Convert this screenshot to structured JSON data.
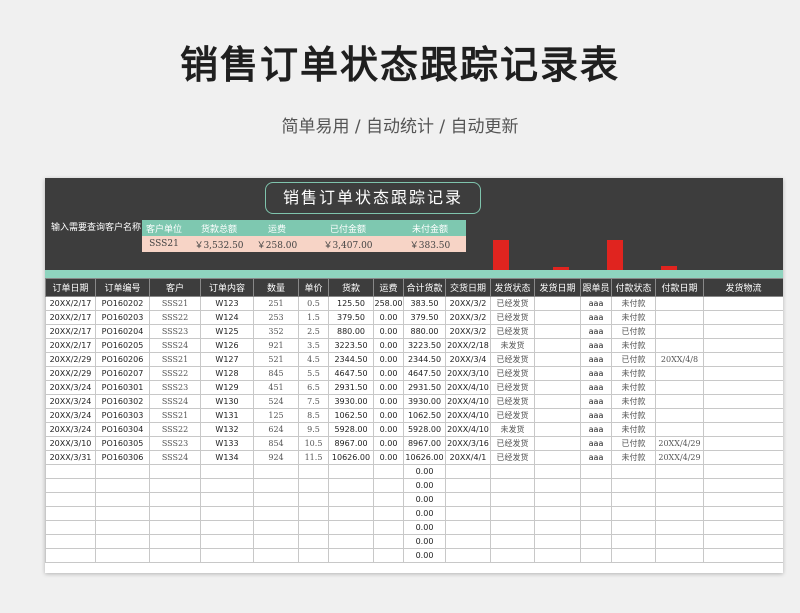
{
  "page": {
    "title": "销售订单状态跟踪记录表",
    "subtitle": "简单易用  /  自动统计  /  自动更新"
  },
  "sheet": {
    "title": "销售订单状态跟踪记录",
    "query_label": "输入需要查询客户名称",
    "summary": {
      "headers": [
        "客户单位",
        "货款总额",
        "运费",
        "已付金额",
        "未付金额"
      ],
      "values": [
        "SSS21",
        "￥3,532.50",
        "￥258.00",
        "￥3,407.00",
        "￥383.50"
      ]
    },
    "chart_data": {
      "type": "bar",
      "categories": [
        "货款总额",
        "运费",
        "已付金额",
        "未付金额"
      ],
      "values": [
        3532.5,
        258,
        3407,
        383.5
      ],
      "title": "",
      "colors": [
        "#e0241f"
      ]
    },
    "table": {
      "columns": [
        "订单日期",
        "订单编号",
        "客户",
        "订单内容",
        "数量",
        "单价",
        "货款",
        "运费",
        "合计货款",
        "交货日期",
        "发货状态",
        "发货日期",
        "跟单员",
        "付款状态",
        "付款日期",
        "发货物流"
      ],
      "rows": [
        [
          "20XX/2/17",
          "PO160202",
          "SSS21",
          "W123",
          "251",
          "0.5",
          "125.50",
          "258.00",
          "383.50",
          "20XX/3/2",
          "已经发货",
          "",
          "aaa",
          "未付款",
          "",
          ""
        ],
        [
          "20XX/2/17",
          "PO160203",
          "SSS22",
          "W124",
          "253",
          "1.5",
          "379.50",
          "0.00",
          "379.50",
          "20XX/3/2",
          "已经发货",
          "",
          "aaa",
          "未付款",
          "",
          ""
        ],
        [
          "20XX/2/17",
          "PO160204",
          "SSS23",
          "W125",
          "352",
          "2.5",
          "880.00",
          "0.00",
          "880.00",
          "20XX/3/2",
          "已经发货",
          "",
          "aaa",
          "已付款",
          "",
          ""
        ],
        [
          "20XX/2/17",
          "PO160205",
          "SSS24",
          "W126",
          "921",
          "3.5",
          "3223.50",
          "0.00",
          "3223.50",
          "20XX/2/18",
          "未发货",
          "",
          "aaa",
          "未付款",
          "",
          ""
        ],
        [
          "20XX/2/29",
          "PO160206",
          "SSS21",
          "W127",
          "521",
          "4.5",
          "2344.50",
          "0.00",
          "2344.50",
          "20XX/3/4",
          "已经发货",
          "",
          "aaa",
          "已付款",
          "20XX/4/8",
          ""
        ],
        [
          "20XX/2/29",
          "PO160207",
          "SSS22",
          "W128",
          "845",
          "5.5",
          "4647.50",
          "0.00",
          "4647.50",
          "20XX/3/10",
          "已经发货",
          "",
          "aaa",
          "未付款",
          "",
          ""
        ],
        [
          "20XX/3/24",
          "PO160301",
          "SSS23",
          "W129",
          "451",
          "6.5",
          "2931.50",
          "0.00",
          "2931.50",
          "20XX/4/10",
          "已经发货",
          "",
          "aaa",
          "未付款",
          "",
          ""
        ],
        [
          "20XX/3/24",
          "PO160302",
          "SSS24",
          "W130",
          "524",
          "7.5",
          "3930.00",
          "0.00",
          "3930.00",
          "20XX/4/10",
          "已经发货",
          "",
          "aaa",
          "未付款",
          "",
          ""
        ],
        [
          "20XX/3/24",
          "PO160303",
          "SSS21",
          "W131",
          "125",
          "8.5",
          "1062.50",
          "0.00",
          "1062.50",
          "20XX/4/10",
          "已经发货",
          "",
          "aaa",
          "未付款",
          "",
          ""
        ],
        [
          "20XX/3/24",
          "PO160304",
          "SSS22",
          "W132",
          "624",
          "9.5",
          "5928.00",
          "0.00",
          "5928.00",
          "20XX/4/10",
          "未发货",
          "",
          "aaa",
          "未付款",
          "",
          ""
        ],
        [
          "20XX/3/10",
          "PO160305",
          "SSS23",
          "W133",
          "854",
          "10.5",
          "8967.00",
          "0.00",
          "8967.00",
          "20XX/3/16",
          "已经发货",
          "",
          "aaa",
          "已付款",
          "20XX/4/29",
          ""
        ],
        [
          "20XX/3/31",
          "PO160306",
          "SSS24",
          "W134",
          "924",
          "11.5",
          "10626.00",
          "0.00",
          "10626.00",
          "20XX/4/1",
          "已经发货",
          "",
          "aaa",
          "未付款",
          "20XX/4/29",
          ""
        ],
        [
          "",
          "",
          "",
          "",
          "",
          "",
          "",
          "",
          "0.00",
          "",
          "",
          "",
          "",
          "",
          "",
          ""
        ],
        [
          "",
          "",
          "",
          "",
          "",
          "",
          "",
          "",
          "0.00",
          "",
          "",
          "",
          "",
          "",
          "",
          ""
        ],
        [
          "",
          "",
          "",
          "",
          "",
          "",
          "",
          "",
          "0.00",
          "",
          "",
          "",
          "",
          "",
          "",
          ""
        ],
        [
          "",
          "",
          "",
          "",
          "",
          "",
          "",
          "",
          "0.00",
          "",
          "",
          "",
          "",
          "",
          "",
          ""
        ],
        [
          "",
          "",
          "",
          "",
          "",
          "",
          "",
          "",
          "0.00",
          "",
          "",
          "",
          "",
          "",
          "",
          ""
        ],
        [
          "",
          "",
          "",
          "",
          "",
          "",
          "",
          "",
          "0.00",
          "",
          "",
          "",
          "",
          "",
          "",
          ""
        ],
        [
          "",
          "",
          "",
          "",
          "",
          "",
          "",
          "",
          "0.00",
          "",
          "",
          "",
          "",
          "",
          "",
          ""
        ]
      ]
    }
  }
}
